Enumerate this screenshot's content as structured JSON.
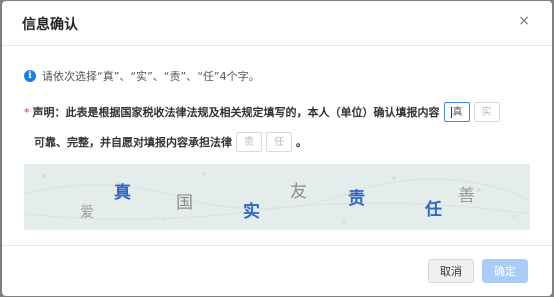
{
  "dialog": {
    "title": "信息确认",
    "close_glyph": "×"
  },
  "tip": {
    "icon": "info-icon",
    "icon_glyph": "i",
    "text": "请依次选择“真”、“实”、“责”、“任”4个字。"
  },
  "declaration": {
    "required_marker": "*",
    "line1": "声明：此表是根据国家税收法律法规及相关规定填写的，本人（单位）确认填报内容",
    "line2": "可靠、完整，并自愿对填报内容承担法律",
    "period": "。",
    "boxes": [
      {
        "value": "真",
        "active": true
      },
      {
        "value": "实",
        "active": false
      },
      {
        "value": "责",
        "active": false
      },
      {
        "value": "任",
        "active": false
      }
    ]
  },
  "captcha": {
    "chars": [
      {
        "text": "爱",
        "color": "#9a9a9a"
      },
      {
        "text": "真",
        "color": "#2f68c4"
      },
      {
        "text": "国",
        "color": "#8c8c8c"
      },
      {
        "text": "实",
        "color": "#2f68c4"
      },
      {
        "text": "友",
        "color": "#8c8c8c"
      },
      {
        "text": "责",
        "color": "#2f68c4"
      },
      {
        "text": "任",
        "color": "#2f68c4"
      },
      {
        "text": "善",
        "color": "#9a9a9a"
      }
    ]
  },
  "footer": {
    "cancel_label": "取消",
    "ok_label": "确定"
  }
}
